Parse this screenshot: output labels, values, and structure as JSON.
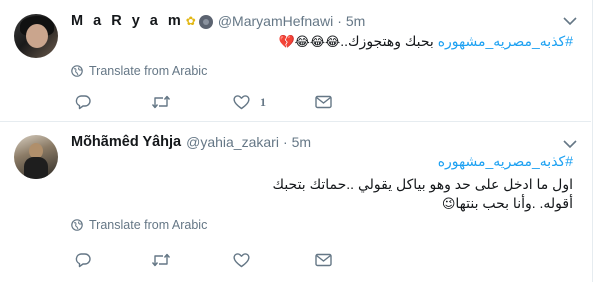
{
  "tweets": [
    {
      "name": "M a R y a m",
      "handle": "@MaryamHefnawi",
      "sep": "·",
      "time": "5m",
      "hashtag": "#كذبه_مصريه_مشهوره",
      "text": " بحبك وهتجوزك..",
      "emoji_tail": "😂😂😂💔",
      "translate": "Translate from Arabic",
      "likes": "1"
    },
    {
      "name": "Mõhãmêd Yâhja",
      "handle": "@yahia_zakari",
      "sep": "·",
      "time": "5m",
      "hashtag": "#كذبه_مصريه_مشهوره",
      "line1": "اول ما ادخل على حد وهو بياكل يقولي ..حماتك بتحبك",
      "line2": "أقوله. .وأنا بحب بنتها",
      "emoji_tail": "😉",
      "translate": "Translate from Arabic",
      "likes": ""
    }
  ],
  "icons": {
    "reply": "reply-icon",
    "retweet": "retweet-icon",
    "like": "heart-icon",
    "dm": "envelope-icon",
    "globe": "globe-icon",
    "chevron": "chevron-down-icon"
  },
  "colors": {
    "hashtag": "#1da1f2",
    "secondary": "#657786",
    "border": "#e6ecf0"
  }
}
